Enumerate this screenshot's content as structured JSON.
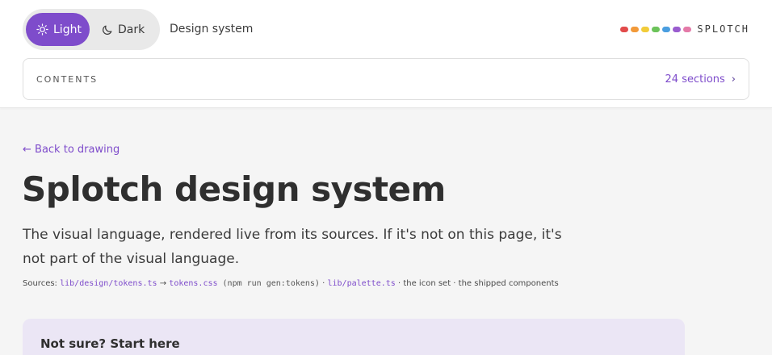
{
  "theme": {
    "light_label": "Light",
    "dark_label": "Dark",
    "active": "Light",
    "accent": "#7e4ccb"
  },
  "header": {
    "design_label": "Design system",
    "brand_name": "SPLOTCH",
    "brand_dot_colors": [
      "#e24b4b",
      "#f29a3a",
      "#f2cc3a",
      "#6cc35a",
      "#4a9ee0",
      "#9a5ccf",
      "#e47aa8"
    ]
  },
  "contents": {
    "label": "CONTENTS",
    "count": "24 sections",
    "chevron": "›"
  },
  "main": {
    "back_link": "← Back to drawing",
    "title": "Splotch design system",
    "intro": "The visual language, rendered live from its sources. If it's not on this page, it's not part of the visual language.",
    "sources": {
      "prefix": "Sources:",
      "tokens_ts": "lib/design/tokens.ts",
      "arrow": " → ",
      "tokens_css": "tokens.css",
      "gen_cmd": " (npm run gen:tokens)",
      "sep1": " · ",
      "palette_ts": "lib/palette.ts",
      "suffix": " · the icon set · the shipped components"
    },
    "callout_title": "Not sure? Start here"
  }
}
